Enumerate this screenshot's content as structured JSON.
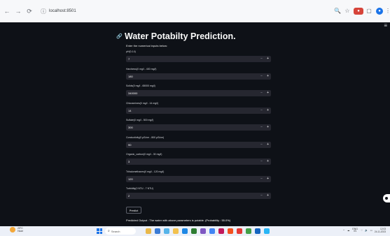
{
  "browser": {
    "url": "localhost:8501",
    "nav_icons": [
      "back-icon",
      "forward-icon",
      "reload-icon",
      "info-icon"
    ],
    "right_icons": [
      "zoom-icon",
      "star-icon",
      "extension-icon",
      "tab-icon",
      "profile-icon",
      "menu-icon"
    ]
  },
  "app": {
    "title": "Water Potabilty Prediction.",
    "subtitle": "Enter the numerical inputs below:",
    "fields": [
      {
        "label": "pH(0-14)",
        "value": "7"
      },
      {
        "label": "Hardness(0 mg/l - 400 mg/l)",
        "value": "180"
      },
      {
        "label": "Solids(0 mg/l - 65000 mg/l)",
        "value": "340000"
      },
      {
        "label": "Chloramines(0 mg/l - 14 mg/l)",
        "value": "14"
      },
      {
        "label": "Sulfate(0 mg/l - 500 mg/l)",
        "value": "300"
      },
      {
        "label": "Conductivity(0 μS/cm - 800 μS/cm)",
        "value": "90"
      },
      {
        "label": "Organic_carbon(0 mg/l - 30 mg/l)",
        "value": "3"
      },
      {
        "label": "Trihalomethanes(0 mg/l - 120 mg/l)",
        "value": "120"
      },
      {
        "label": "Turbidity(0 NTU - 7 NTU)",
        "value": "2"
      }
    ],
    "minus_symbol": "−",
    "plus_symbol": "+",
    "predict_label": "Predict",
    "output_text": "Predicted Output : The water with above parameters is potable. (Probability : 55.0%)"
  },
  "taskbar": {
    "weather_temp": "29°C",
    "weather_desc": "Haze",
    "search_placeholder": "Search",
    "lang": "ENG",
    "lang_region": "IN",
    "time": "12:03",
    "date": "24-11-2023"
  },
  "colors": {
    "app_bg": "#0e1117",
    "input_bg": "#262730",
    "text": "#fafafa",
    "browser_bg": "#f7f8fa",
    "taskbar_bg": "#ecf0f8"
  }
}
